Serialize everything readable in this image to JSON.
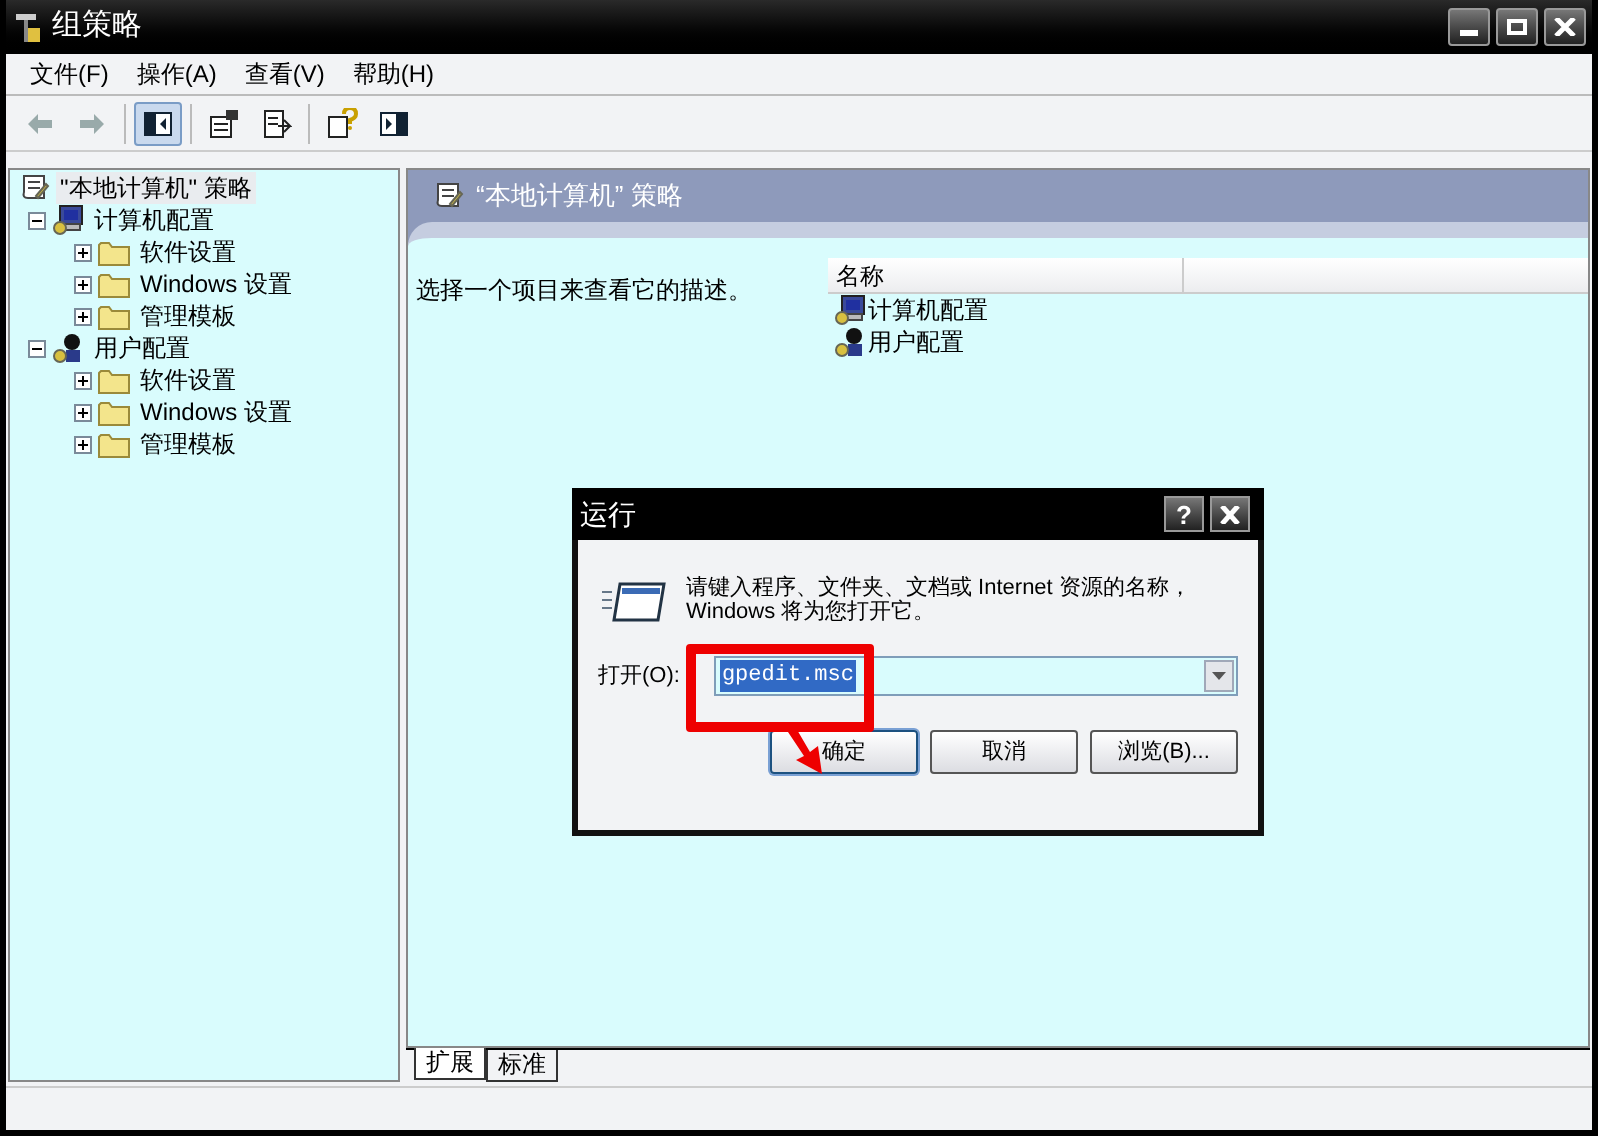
{
  "window": {
    "title": "组策略"
  },
  "menu": [
    "文件(F)",
    "操作(A)",
    "查看(V)",
    "帮助(H)"
  ],
  "toolbar": [
    {
      "kind": "back",
      "disabled": true
    },
    {
      "kind": "forward",
      "disabled": true
    },
    {
      "kind": "tree",
      "selected": true
    },
    {
      "kind": "properties",
      "selected": false
    },
    {
      "kind": "export",
      "selected": false
    },
    {
      "kind": "help",
      "selected": false
    },
    {
      "kind": "pane",
      "selected": false
    }
  ],
  "tree": [
    {
      "label": "\"本地计算机\" 策略",
      "kind": "policy",
      "selected": true,
      "children": [
        {
          "label": "计算机配置",
          "kind": "computer",
          "selected": false,
          "expanded": true,
          "children": [
            {
              "label": "软件设置",
              "kind": "folder",
              "selected": false,
              "expanded": false
            },
            {
              "label": "Windows 设置",
              "kind": "folder",
              "selected": false,
              "expanded": false
            },
            {
              "label": "管理模板",
              "kind": "folder",
              "selected": false,
              "expanded": false
            }
          ]
        },
        {
          "label": "用户配置",
          "kind": "user",
          "selected": false,
          "expanded": true,
          "children": [
            {
              "label": "软件设置",
              "kind": "folder",
              "selected": false,
              "expanded": false
            },
            {
              "label": "Windows 设置",
              "kind": "folder",
              "selected": false,
              "expanded": false
            },
            {
              "label": "管理模板",
              "kind": "folder",
              "selected": false,
              "expanded": false
            }
          ]
        }
      ]
    }
  ],
  "detail": {
    "header": "“本地计算机” 策略",
    "description": "选择一个项目来查看它的描述。",
    "columns": [
      "名称"
    ],
    "items": [
      {
        "label": "计算机配置",
        "kind": "computer"
      },
      {
        "label": "用户配置",
        "kind": "user"
      }
    ]
  },
  "view_tabs": [
    {
      "label": "扩展",
      "selected": true
    },
    {
      "label": "标准",
      "selected": false
    }
  ],
  "run_dialog": {
    "title": "运行",
    "help": "?",
    "message": "请键入程序、文件夹、文档或 Internet 资源的名称，Windows 将为您打开它。",
    "open_label": "打开(O):",
    "value": "gpedit.msc",
    "buttons": [
      {
        "label": "确定",
        "selected": true
      },
      {
        "label": "取消",
        "selected": false
      },
      {
        "label": "浏览(B)...",
        "selected": false
      }
    ]
  }
}
